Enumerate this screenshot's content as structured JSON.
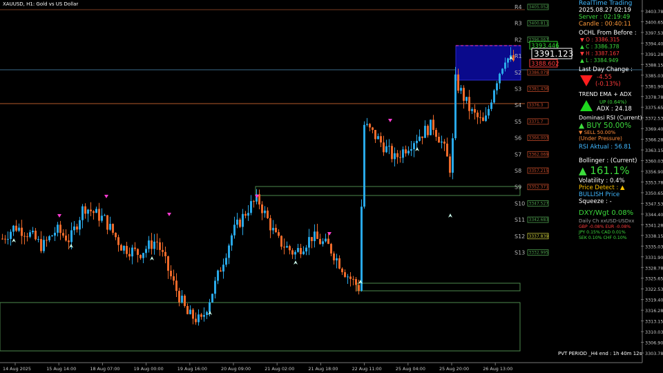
{
  "header": {
    "symbol": "XAUUSD, H1:  Gold vs US Dollar"
  },
  "colors": {
    "bull": "#29a9e8",
    "bear": "#ef6a2a",
    "bg": "#000000",
    "text": "#ffffff",
    "grid_green": "#4e8a4e",
    "grid_orange": "#b35a2a"
  },
  "chart_data": {
    "type": "candlestick",
    "title": "",
    "xlabel": "",
    "ylabel": "",
    "ylim": [
      3302.0,
      3406.0
    ],
    "y_ticks": [
      "3403.780",
      "3400.655",
      "3397.530",
      "3394.405",
      "3391.280",
      "3388.155",
      "3385.030",
      "3381.905",
      "3378.780",
      "3375.655",
      "3372.530",
      "3369.405",
      "3366.280",
      "3363.155",
      "3360.030",
      "3356.905",
      "3353.780",
      "3350.655",
      "3347.530",
      "3344.405",
      "3341.280",
      "3338.155",
      "3335.030",
      "3331.905",
      "3328.780",
      "3325.655",
      "3322.530",
      "3319.405",
      "3316.280",
      "3313.155",
      "3310.030",
      "3306.905",
      "3303.780"
    ],
    "x_ticks": [
      "14 Aug 2025",
      "15 Aug 14:00",
      "18 Aug 07:00",
      "19 Aug 00:00",
      "19 Aug 16:00",
      "20 Aug 09:00",
      "21 Aug 02:00",
      "21 Aug 18:00",
      "22 Aug 11:00",
      "25 Aug 04:00",
      "25 Aug 20:00",
      "26 Aug 13:00"
    ],
    "current_price": "3391.123",
    "ask_label": "3393.446",
    "bid_label": "3388.602",
    "levels": [
      {
        "name": "R4",
        "price": "3405.052",
        "value": 3405.05,
        "kind": "r"
      },
      {
        "name": "R3",
        "price": "3400.811",
        "value": 3400.81,
        "kind": "r"
      },
      {
        "name": "R2",
        "price": "3396.067",
        "value": 3396.07,
        "kind": "r"
      },
      {
        "name": "R1",
        "price": "",
        "value": 3391.8,
        "kind": "r"
      },
      {
        "name": "S2",
        "price": "3386.079",
        "value": 3386.08,
        "kind": "s"
      },
      {
        "name": "S3",
        "price": "3381.436",
        "value": 3381.44,
        "kind": "s"
      },
      {
        "name": "S4",
        "price": "3376.3",
        "value": 3376.3,
        "kind": "s"
      },
      {
        "name": "S5",
        "price": "3371.7",
        "value": 3371.7,
        "kind": "s"
      },
      {
        "name": "S6",
        "price": "3366.003",
        "value": 3366.0,
        "kind": "s"
      },
      {
        "name": "S7",
        "price": "3362.069",
        "value": 3362.07,
        "kind": "s"
      },
      {
        "name": "S8",
        "price": "3357.215",
        "value": 3357.22,
        "kind": "s"
      },
      {
        "name": "S9",
        "price": "3352.371",
        "value": 3352.37,
        "kind": "s"
      },
      {
        "name": "S10",
        "price": "3347.527",
        "value": 3347.53,
        "kind": "g"
      },
      {
        "name": "S11",
        "price": "3342.683",
        "value": 3342.68,
        "kind": "g"
      },
      {
        "name": "S12",
        "price": "3337.839",
        "value": 3337.84,
        "kind": "y"
      },
      {
        "name": "S13",
        "price": "3332.995",
        "value": 3332.99,
        "kind": "g"
      }
    ]
  },
  "panel": {
    "title": "RealTime Trading",
    "datetime": "2025.08.27 02:19",
    "server": "Server : 02:19:49",
    "candle": "Candle : 00:40:11",
    "ochl_title": "OCHL From Before :",
    "o": "▼ O : 3386.315",
    "c": "▲ C : 3386.378",
    "h": "▼ H : 3387.167",
    "l": "▲ L : 3384.949",
    "ldc_title": "Last Day Change :",
    "ldc_val": "-4.55",
    "ldc_pct": "(-0.13%)",
    "trend_title": "TREND EMA + ADX",
    "trend_up": "UP (0.64%)",
    "adx": "ADX : 24.18",
    "rsi_title": "Dominasi RSI (Current)",
    "buy": "▲ BUY 50.00%",
    "sell": "▼ SELL 50.00%",
    "pressure": "(Under Pressure)",
    "rsi_aktual": "RSI Aktual : 56.81",
    "boll_title": "Bollinger : (Current)",
    "boll_val": "▲ 161.1%",
    "volatility": "Volatility : 0.4%",
    "price_detect": "Price Detect : ▲",
    "bullish": "BULLISH Price",
    "squeeze": "Squeeze : -",
    "dxy": "DXY/Wgt 0.08%",
    "daily": "Daily Ch xxUSD-USDxx",
    "cur1": "GBP  -0.08%  EUR  -0.08%",
    "cur2": "JPY   0.15%  CAD   0.01%",
    "cur3": "SEK   0.10%  CHF   0.10%"
  },
  "footer": {
    "pvt": "PVT PERIOD _H4 end : 1h 40m 12s"
  }
}
